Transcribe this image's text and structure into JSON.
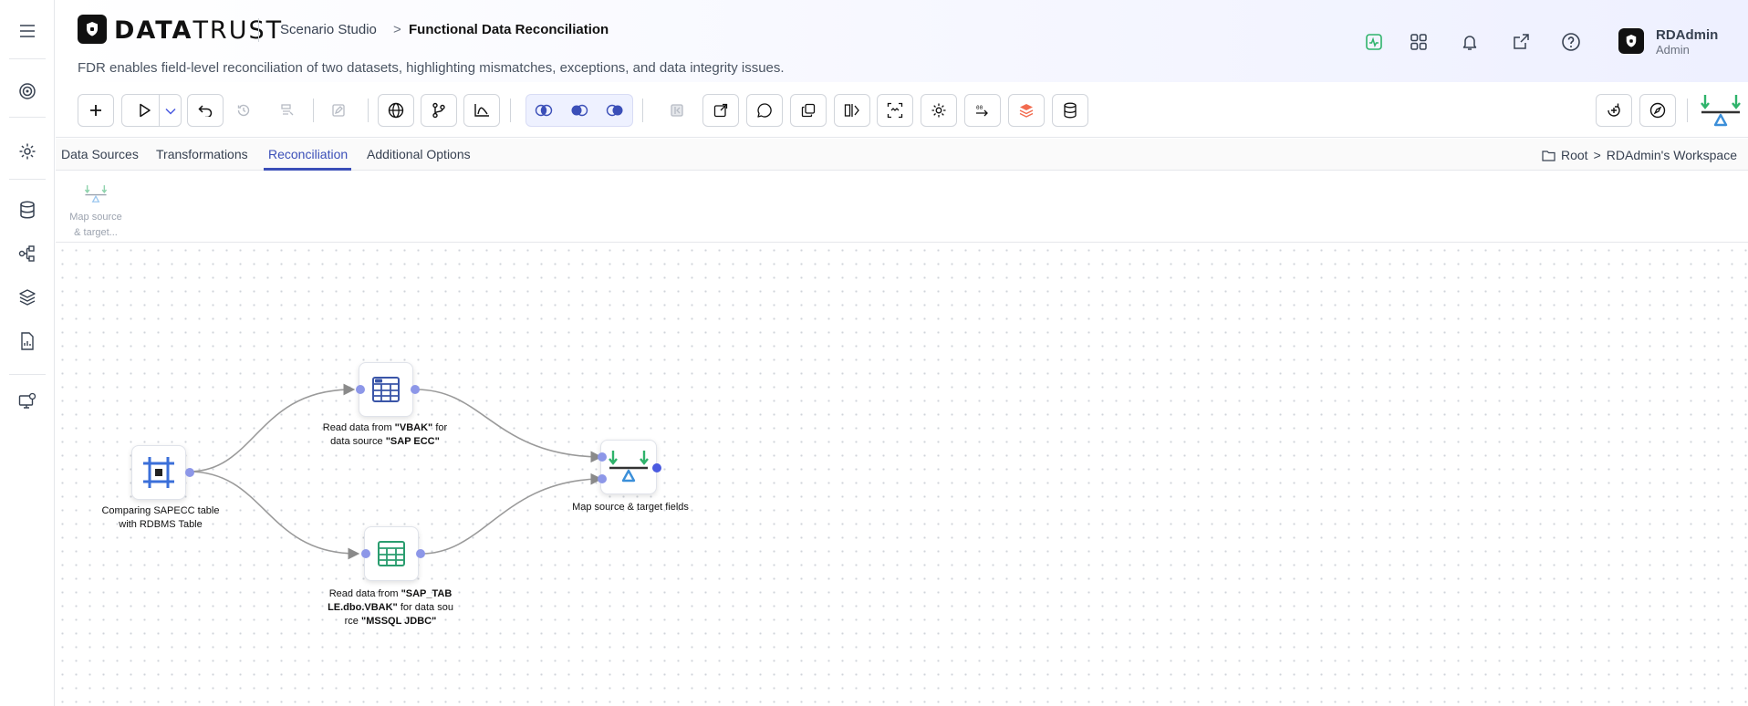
{
  "app": {
    "logo_bold": "DATA",
    "logo_light": "TRUST",
    "breadcrumb_studio": "Scenario Studio",
    "breadcrumb_sep": ">",
    "page_title": "Functional Data Reconciliation",
    "subtitle": "FDR enables field-level reconciliation of two datasets, highlighting mismatches, exceptions, and data integrity issues."
  },
  "user": {
    "name": "RDAdmin",
    "role": "Admin"
  },
  "tabs": [
    {
      "label": "Data Sources"
    },
    {
      "label": "Transformations"
    },
    {
      "label": "Reconciliation"
    },
    {
      "label": "Additional Options"
    }
  ],
  "workspace": {
    "root": "Root",
    "sep": ">",
    "name": "RDAdmin's Workspace"
  },
  "palette": {
    "line1": "Map source",
    "line2": "& target..."
  },
  "nodes": {
    "source": {
      "line1": "Comparing SAPECC table",
      "line2": "with RDBMS Table"
    },
    "vbak": {
      "p1": "Read data from ",
      "b1": "\"VBAK\"",
      "p2": " for",
      "p3": "data source ",
      "b2": "\"SAP ECC\""
    },
    "mssql": {
      "p1": "Read data from ",
      "b1": "\"SAP_TAB",
      "b2": "LE.dbo.VBAK\"",
      "p2": " for data sou",
      "p3": "rce ",
      "b3": "\"MSSQL JDBC\""
    },
    "map": {
      "label": "Map source & target fields"
    }
  },
  "colors": {
    "accent": "#3b4fb8",
    "port": "#8d97e8",
    "green": "#2fb36b",
    "teal": "#2a9d8f"
  }
}
